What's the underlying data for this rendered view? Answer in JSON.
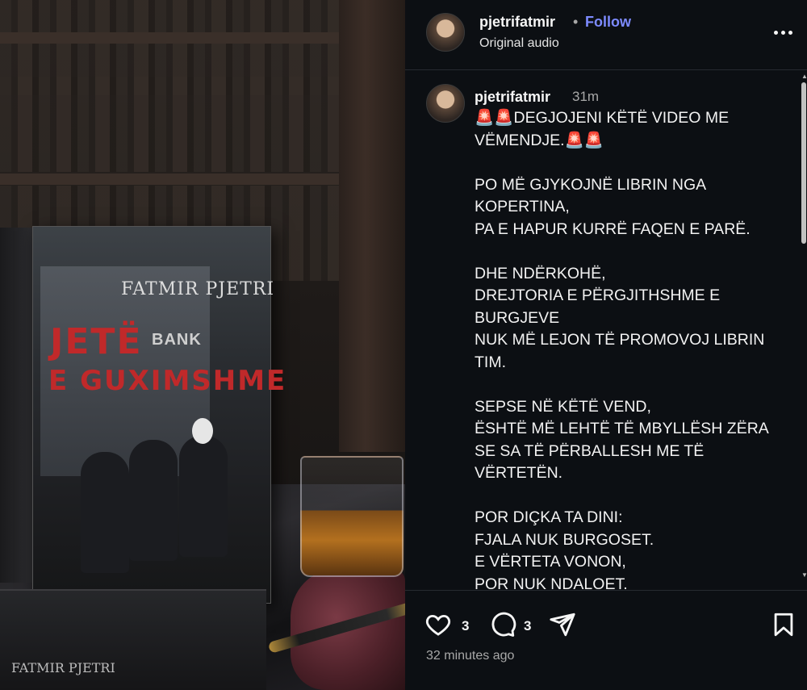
{
  "header": {
    "username": "pjetrifatmir",
    "separator": "•",
    "follow_label": "Follow",
    "audio_label": "Original audio"
  },
  "caption": {
    "username": "pjetrifatmir",
    "time": "31m",
    "text": "🚨🚨DEGJOJENI KËTË VIDEO ME\nVËMENDJE.🚨🚨\n\nPO MË GJYKOJNË LIBRIN NGA\nKOPERTINA,\nPA E HAPUR KURRË FAQEN E PARË.\n\nDHE NDËRKOHË,\nDREJTORIA E PËRGJITHSHME E\nBURGJEVE\nNUK MË LEJON TË PROMOVOJ LIBRIN\nTIM.\n\nSEPSE NË KËTË VEND,\nËSHTË MË LEHTË TË MBYLLËSH ZËRA\nSE SA TË PËRBALLESH ME TË VËRTETËN.\n\nPOR DIÇKA TA DINI:\nFJALA NUK BURGOSET.\nE VËRTETA VONON,\nPOR NUK NDALOET."
  },
  "actions": {
    "like_count": "3",
    "comment_count": "3",
    "time_ago": "32 minutes ago"
  },
  "media": {
    "book_author": "FATMIR PJETRI",
    "book_title_line1": "JETË",
    "book_title_line2": "E GUXIMSHME",
    "bank_sign": "BANK",
    "book2_author": "FATMIR PJETRI"
  },
  "icons": {
    "like": "heart-icon",
    "comment": "comment-icon",
    "share": "share-icon",
    "save": "bookmark-icon",
    "more": "more-options-icon"
  },
  "colors": {
    "follow": "#7d8bff",
    "background": "#0c0f13",
    "title_red": "#c0292a"
  }
}
